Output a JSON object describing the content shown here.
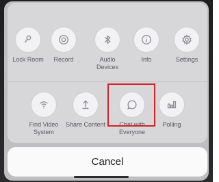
{
  "actions_top": [
    {
      "label": "Lock Room",
      "icon": "lock-icon"
    },
    {
      "label": "Record",
      "icon": "record-icon"
    },
    {
      "label": "Audio\nDevices",
      "icon": "bluetooth-icon"
    },
    {
      "label": "Info",
      "icon": "info-icon"
    },
    {
      "label": "Settings",
      "icon": "gear-icon"
    }
  ],
  "actions_bottom": [
    {
      "label": "Find Video\nSystem",
      "icon": "wifi-icon"
    },
    {
      "label": "Share Content",
      "icon": "share-icon"
    },
    {
      "label": "Chat with\nEveryone",
      "icon": "chat-icon"
    },
    {
      "label": "Polling",
      "icon": "poll-icon"
    }
  ],
  "cancel_label": "Cancel",
  "colors": {
    "highlight": "#d2232a",
    "icon": "#8d8d92",
    "sheet": "#d7d7d9"
  }
}
